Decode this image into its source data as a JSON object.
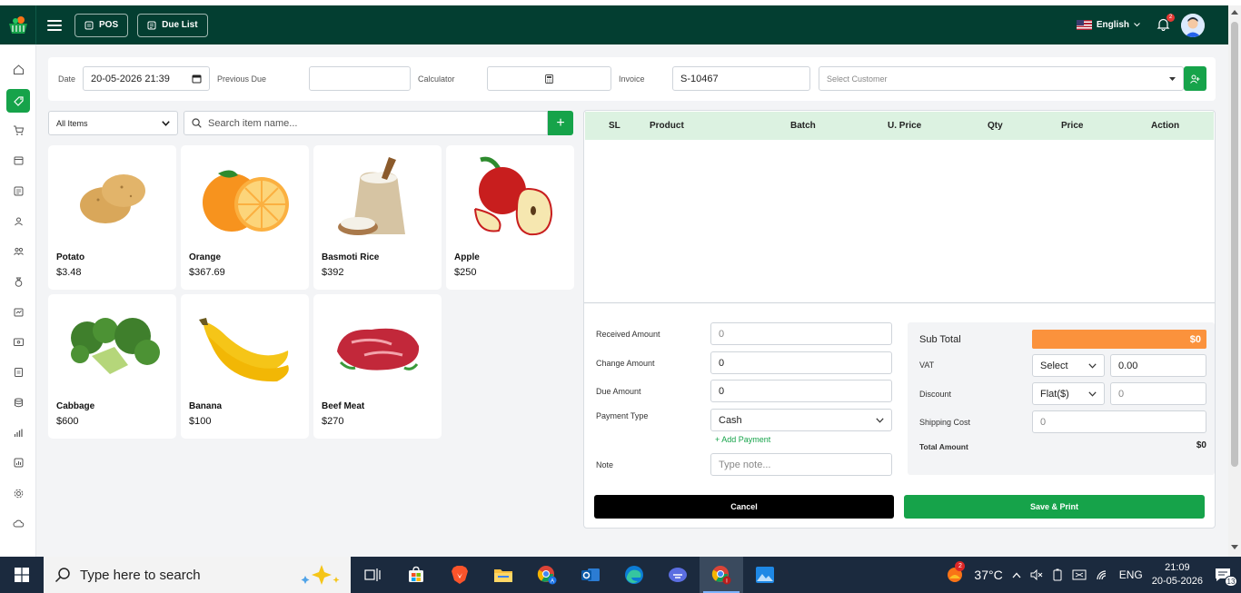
{
  "header": {
    "pos_label": "POS",
    "due_list_label": "Due List",
    "language": "English",
    "notification_count": "2"
  },
  "filters": {
    "date_label": "Date",
    "date_value": "20-05-2026 21:39",
    "previous_due_label": "Previous Due",
    "previous_due_value": "",
    "calculator_label": "Calculator",
    "invoice_label": "Invoice",
    "invoice_value": "S-10467",
    "customer_placeholder": "Select Customer"
  },
  "catalog": {
    "category": "All Items",
    "search_placeholder": "Search item name...",
    "products": [
      {
        "name": "Potato",
        "price": "$3.48"
      },
      {
        "name": "Orange",
        "price": "$367.69"
      },
      {
        "name": "Basmoti Rice",
        "price": "$392"
      },
      {
        "name": "Apple",
        "price": "$250"
      },
      {
        "name": "Cabbage",
        "price": "$600"
      },
      {
        "name": "Banana",
        "price": "$100"
      },
      {
        "name": "Beef Meat",
        "price": "$270"
      }
    ]
  },
  "cart": {
    "columns": [
      "SL",
      "Product",
      "Batch",
      "U. Price",
      "Qty",
      "Price",
      "Action"
    ]
  },
  "payment": {
    "received_label": "Received Amount",
    "received_placeholder": "0",
    "change_label": "Change Amount",
    "change_value": "0",
    "due_label": "Due Amount",
    "due_value": "0",
    "type_label": "Payment Type",
    "type_value": "Cash",
    "add_payment": "+ Add Payment",
    "note_label": "Note",
    "note_placeholder": "Type note..."
  },
  "totals": {
    "subtotal_label": "Sub Total",
    "subtotal_value": "$0",
    "vat_label": "VAT",
    "vat_select": "Select",
    "vat_value": "0.00",
    "discount_label": "Discount",
    "discount_select": "Flat($)",
    "discount_placeholder": "0",
    "shipping_label": "Shipping Cost",
    "shipping_placeholder": "0",
    "total_label": "Total Amount",
    "total_value": "$0"
  },
  "actions": {
    "cancel": "Cancel",
    "save_print": "Save & Print"
  },
  "taskbar": {
    "search_placeholder": "Type here to search",
    "temperature": "37°C",
    "weather_badge": "2",
    "language": "ENG",
    "time": "21:09",
    "date": "20-05-2026",
    "notification_count": "13"
  },
  "colors": {
    "header": "#033e31",
    "accent": "#16a34a",
    "subtotal": "#fb923c",
    "table_header": "#dcf2e1"
  }
}
